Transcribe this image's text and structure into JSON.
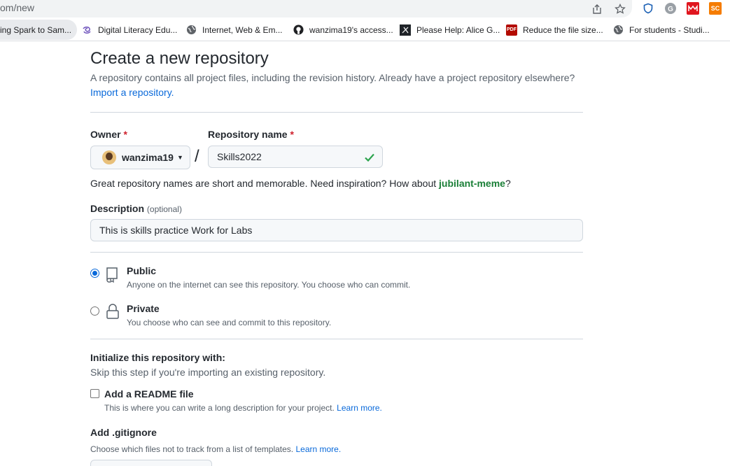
{
  "browser": {
    "url": "om/new",
    "bookmarks": [
      {
        "label": "ing Spark to Sam...",
        "icon": "bookmark-favicon"
      },
      {
        "label": "Digital Literacy Edu...",
        "icon": "spiral-icon"
      },
      {
        "label": "Internet, Web & Em...",
        "icon": "globe-icon"
      },
      {
        "label": "wanzima19's access...",
        "icon": "github-icon"
      },
      {
        "label": "Please Help: Alice G...",
        "icon": "x-icon"
      },
      {
        "label": "Reduce the file size...",
        "icon": "pdf-icon"
      },
      {
        "label": "For students - Studi...",
        "icon": "globe-icon"
      }
    ],
    "extensions": {
      "sc_label": "SC",
      "pdf_label": "PDF"
    }
  },
  "page": {
    "title": "Create a new repository",
    "subtitle": "A repository contains all project files, including the revision history. Already have a project repository elsewhere?",
    "import_link": "Import a repository."
  },
  "form": {
    "owner_label": "Owner",
    "required_mark": "*",
    "owner_value": "wanzima19",
    "repo_name_label": "Repository name",
    "repo_name_value": "Skills2022",
    "separator": "/",
    "hint_prefix": "Great repository names are short and memorable. Need inspiration? How about ",
    "hint_suggestion": "jubilant-meme",
    "hint_suffix": "?",
    "description_label": "Description",
    "description_optional": "(optional)",
    "description_value": "This is skills practice Work for Labs",
    "visibility": {
      "public_title": "Public",
      "public_desc": "Anyone on the internet can see this repository. You choose who can commit.",
      "private_title": "Private",
      "private_desc": "You choose who can see and commit to this repository.",
      "selected": "public"
    },
    "init_title": "Initialize this repository with:",
    "init_sub": "Skip this step if you're importing an existing repository.",
    "readme_label": "Add a README file",
    "readme_desc": "This is where you can write a long description for your project.",
    "learn_more": "Learn more.",
    "gitignore_title": "Add .gitignore",
    "gitignore_desc": "Choose which files not to track from a list of templates."
  },
  "colors": {
    "accent": "#0969da",
    "success": "#1a7f37",
    "danger": "#cf222e"
  }
}
